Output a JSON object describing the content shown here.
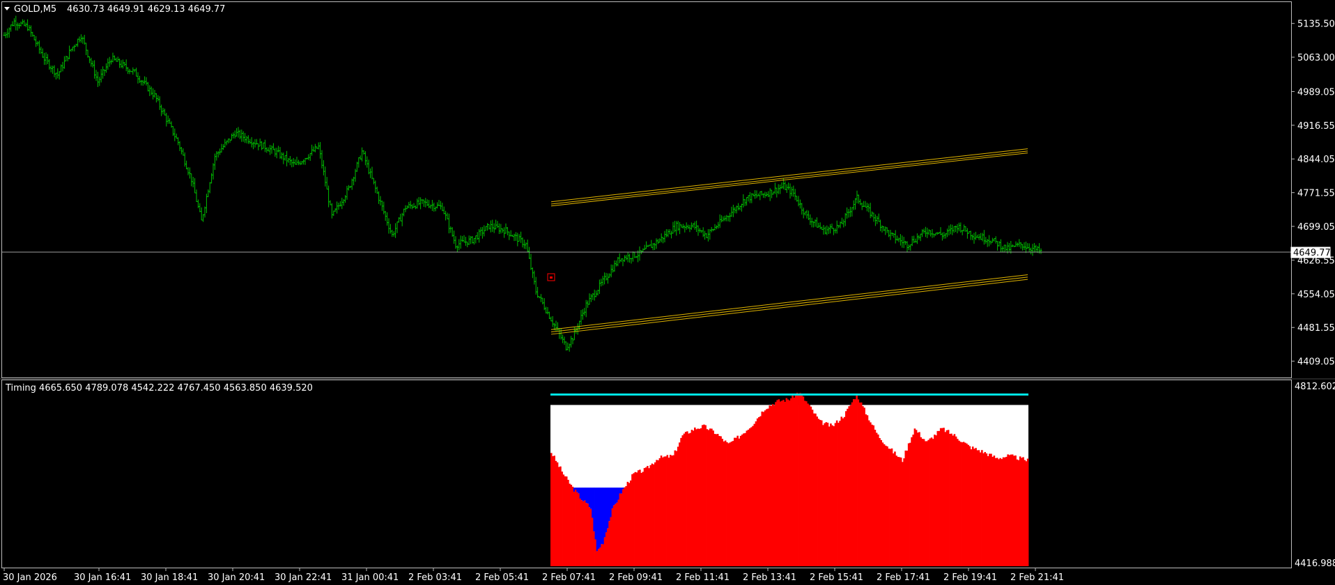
{
  "main_chart": {
    "symbol_caption": "GOLD,M5",
    "ohlc_caption": "4630.73 4649.91 4629.13 4649.77",
    "current_price_label": "4649.77",
    "price_ticks": [
      "5135.50",
      "5063.00",
      "4989.05",
      "4916.55",
      "4844.05",
      "4771.55",
      "4699.05",
      "4626.55",
      "4554.05",
      "4481.55",
      "4409.05"
    ]
  },
  "indicator": {
    "caption": "Timing 4665.650 4789.078 4542.222 4767.450 4563.850 4639.520",
    "scale_top": "4812.602",
    "scale_bottom": "4416.988"
  },
  "time_axis": {
    "labels": [
      "30 Jan 2026",
      "30 Jan 16:41",
      "30 Jan 18:41",
      "30 Jan 20:41",
      "30 Jan 22:41",
      "31 Jan 00:41",
      "2 Feb 03:41",
      "2 Feb 05:41",
      "2 Feb 07:41",
      "2 Feb 09:41",
      "2 Feb 11:41",
      "2 Feb 13:41",
      "2 Feb 15:41",
      "2 Feb 17:41",
      "2 Feb 19:41",
      "2 Feb 21:41"
    ]
  },
  "colors": {
    "background": "#000000",
    "bar": "#00c000",
    "channel": "#e0b400",
    "indicator_fill": "#ff0000",
    "indicator_below": "#0000ff",
    "indicator_area": "#ffffff",
    "indicator_level": "#00e5e5",
    "grid_line": "#a0a0a0",
    "marker": "#ff0000"
  },
  "chart_data": [
    {
      "type": "ohlc_bar",
      "ylim": [
        4395.0,
        5165.0
      ],
      "price_anchors": [
        [
          0,
          5110
        ],
        [
          6,
          5140
        ],
        [
          14,
          5128
        ],
        [
          24,
          5060
        ],
        [
          32,
          5025
        ],
        [
          40,
          5080
        ],
        [
          46,
          5110
        ],
        [
          56,
          5010
        ],
        [
          64,
          5060
        ],
        [
          78,
          5030
        ],
        [
          90,
          4980
        ],
        [
          104,
          4880
        ],
        [
          112,
          4800
        ],
        [
          118,
          4710
        ],
        [
          126,
          4850
        ],
        [
          138,
          4900
        ],
        [
          150,
          4880
        ],
        [
          162,
          4860
        ],
        [
          174,
          4830
        ],
        [
          188,
          4870
        ],
        [
          196,
          4720
        ],
        [
          206,
          4780
        ],
        [
          214,
          4860
        ],
        [
          224,
          4760
        ],
        [
          232,
          4680
        ],
        [
          240,
          4740
        ],
        [
          250,
          4750
        ],
        [
          262,
          4740
        ],
        [
          270,
          4660
        ],
        [
          280,
          4670
        ],
        [
          290,
          4700
        ],
        [
          300,
          4690
        ],
        [
          312,
          4660
        ],
        [
          318,
          4560
        ],
        [
          324,
          4520
        ],
        [
          330,
          4480
        ],
        [
          336,
          4440
        ],
        [
          340,
          4460
        ],
        [
          348,
          4530
        ],
        [
          358,
          4580
        ],
        [
          368,
          4630
        ],
        [
          380,
          4640
        ],
        [
          392,
          4670
        ],
        [
          402,
          4700
        ],
        [
          412,
          4700
        ],
        [
          420,
          4680
        ],
        [
          432,
          4720
        ],
        [
          444,
          4760
        ],
        [
          456,
          4770
        ],
        [
          466,
          4785
        ],
        [
          472,
          4770
        ],
        [
          480,
          4720
        ],
        [
          490,
          4690
        ],
        [
          500,
          4700
        ],
        [
          510,
          4760
        ],
        [
          520,
          4720
        ],
        [
          530,
          4680
        ],
        [
          540,
          4660
        ],
        [
          552,
          4690
        ],
        [
          562,
          4680
        ],
        [
          570,
          4700
        ],
        [
          580,
          4680
        ],
        [
          590,
          4670
        ],
        [
          600,
          4650
        ],
        [
          608,
          4660
        ],
        [
          620,
          4645
        ]
      ]
    },
    {
      "type": "line",
      "series": [
        {
          "x": [
            0,
            620
          ],
          "y": [
            4752,
            4866
          ]
        },
        {
          "x": [
            0,
            620
          ],
          "y": [
            4747,
            4861
          ]
        },
        {
          "x": [
            0,
            620
          ],
          "y": [
            4743,
            4857
          ]
        },
        {
          "x": [
            0,
            620
          ],
          "y": [
            4477,
            4595
          ]
        },
        {
          "x": [
            0,
            620
          ],
          "y": [
            4472,
            4590
          ]
        },
        {
          "x": [
            0,
            620
          ],
          "y": [
            4467,
            4585
          ]
        }
      ]
    },
    {
      "type": "area",
      "ylim": [
        4416.988,
        4812.602
      ],
      "area_top": 4772.0,
      "baseline": 4590.0,
      "level": 4795.0,
      "values_anchors": [
        [
          0,
          4668
        ],
        [
          8,
          4620
        ],
        [
          14,
          4590
        ],
        [
          20,
          4565
        ],
        [
          26,
          4545
        ],
        [
          30,
          4450
        ],
        [
          34,
          4470
        ],
        [
          40,
          4540
        ],
        [
          46,
          4580
        ],
        [
          54,
          4620
        ],
        [
          62,
          4630
        ],
        [
          70,
          4655
        ],
        [
          80,
          4660
        ],
        [
          86,
          4705
        ],
        [
          94,
          4720
        ],
        [
          100,
          4725
        ],
        [
          108,
          4710
        ],
        [
          116,
          4685
        ],
        [
          124,
          4705
        ],
        [
          132,
          4730
        ],
        [
          140,
          4765
        ],
        [
          148,
          4780
        ],
        [
          156,
          4785
        ],
        [
          162,
          4800
        ],
        [
          168,
          4775
        ],
        [
          176,
          4735
        ],
        [
          184,
          4725
        ],
        [
          192,
          4750
        ],
        [
          200,
          4795
        ],
        [
          206,
          4755
        ],
        [
          214,
          4705
        ],
        [
          222,
          4675
        ],
        [
          230,
          4650
        ],
        [
          238,
          4720
        ],
        [
          246,
          4690
        ],
        [
          256,
          4720
        ],
        [
          264,
          4705
        ],
        [
          274,
          4680
        ],
        [
          282,
          4670
        ],
        [
          292,
          4655
        ],
        [
          300,
          4660
        ],
        [
          312,
          4650
        ]
      ]
    }
  ]
}
